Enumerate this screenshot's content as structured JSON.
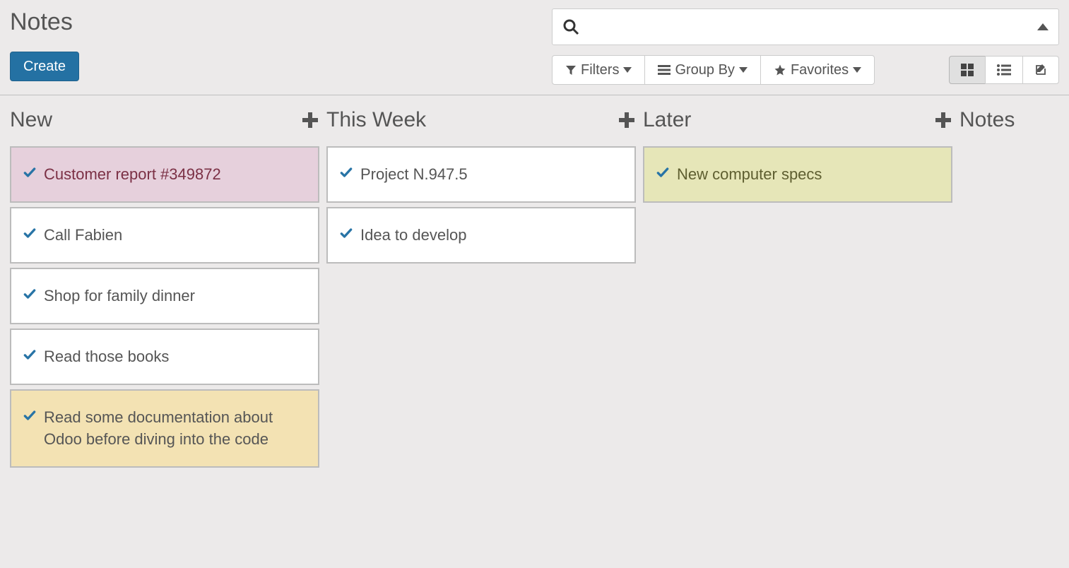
{
  "header": {
    "title": "Notes",
    "create_label": "Create",
    "search_placeholder": "",
    "filters_label": "Filters",
    "groupby_label": "Group By",
    "favorites_label": "Favorites"
  },
  "columns": [
    {
      "title": "New",
      "has_add": true,
      "cards": [
        {
          "text": "Customer report #349872",
          "color": "pink"
        },
        {
          "text": "Call Fabien",
          "color": ""
        },
        {
          "text": "Shop for family dinner",
          "color": ""
        },
        {
          "text": "Read those books",
          "color": ""
        },
        {
          "text": "Read some documentation about Odoo before diving into the code",
          "color": "yellow"
        }
      ]
    },
    {
      "title": "This Week",
      "has_add": true,
      "cards": [
        {
          "text": "Project N.947.5",
          "color": ""
        },
        {
          "text": "Idea to develop",
          "color": ""
        }
      ]
    },
    {
      "title": "Later",
      "has_add": true,
      "cards": [
        {
          "text": "New computer specs",
          "color": "olive"
        }
      ]
    },
    {
      "title": "Notes",
      "has_add": false,
      "cards": []
    }
  ]
}
